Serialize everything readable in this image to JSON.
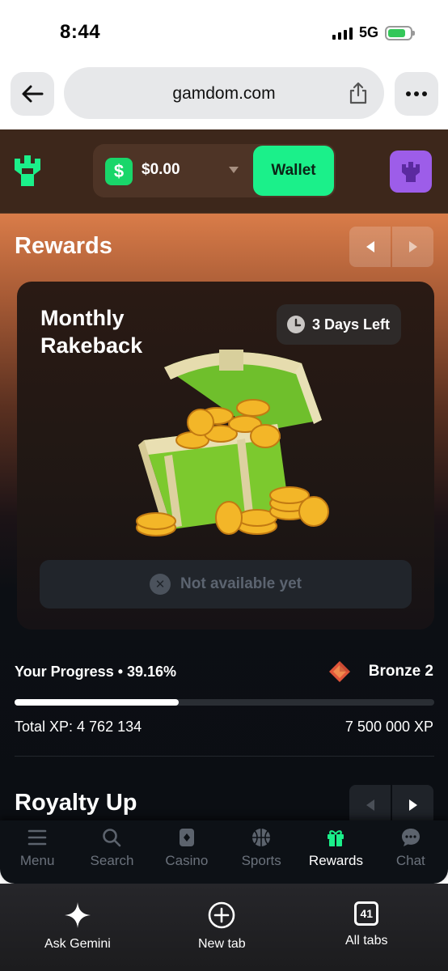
{
  "status_bar": {
    "time": "8:44",
    "network": "5G",
    "battery_color": "#34c759"
  },
  "browser": {
    "url": "gamdom.com",
    "back_icon": "arrow-left-icon",
    "share_icon": "share-icon",
    "more_icon": "ellipsis-icon"
  },
  "header": {
    "currency_symbol": "$",
    "balance": "$0.00",
    "wallet_label": "Wallet",
    "accent_color": "#1bf08a",
    "avatar_color": "#9d5de9"
  },
  "rewards": {
    "title": "Rewards",
    "card": {
      "title": "Monthly Rakeback",
      "time_left": "3 Days Left",
      "status": "Not available yet"
    }
  },
  "progress": {
    "label": "Your Progress • 39.16%",
    "percent": 39.16,
    "rank": "Bronze 2",
    "total_xp": "Total XP: 4 762 134",
    "target_xp": "7 500 000 XP"
  },
  "royalty": {
    "title": "Royalty Up"
  },
  "site_nav": [
    {
      "label": "Menu",
      "icon": "menu-icon"
    },
    {
      "label": "Search",
      "icon": "search-icon"
    },
    {
      "label": "Casino",
      "icon": "casino-icon"
    },
    {
      "label": "Sports",
      "icon": "basketball-icon"
    },
    {
      "label": "Rewards",
      "icon": "gift-icon",
      "active": true
    },
    {
      "label": "Chat",
      "icon": "chat-icon"
    }
  ],
  "safari_bar": {
    "ask_gemini": "Ask Gemini",
    "new_tab": "New tab",
    "all_tabs": "All tabs",
    "tab_count": "41"
  }
}
